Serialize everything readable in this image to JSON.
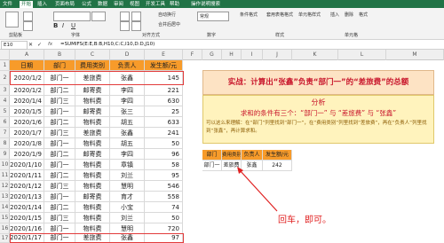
{
  "menu": {
    "tabs": [
      "文件",
      "开始",
      "插入",
      "页面布局",
      "公式",
      "数据",
      "审阅",
      "视图",
      "开发工具",
      "帮助",
      "操作说明搜索"
    ],
    "active": "开始"
  },
  "ribbon": {
    "groups": [
      "剪贴板",
      "字体",
      "对齐方式",
      "数字",
      "样式",
      "单元格"
    ],
    "buttons": [
      "自动换行",
      "合并后居中",
      "常规",
      "条件格式",
      "套用表格格式",
      "单元格样式",
      "插入",
      "删除",
      "格式"
    ]
  },
  "formula_bar": {
    "name_box": "E10",
    "fx": "fx",
    "formula": "=SUMIFS(E:E,B:B,H10,C:C,I10,D:D,J10)"
  },
  "columns": [
    "A",
    "B",
    "C",
    "D",
    "E",
    "F",
    "G",
    "H",
    "I",
    "J",
    "K",
    "L",
    "M"
  ],
  "row_numbers": [
    "1",
    "2",
    "3",
    "4",
    "5",
    "6",
    "7",
    "8",
    "9",
    "10",
    "11",
    "12",
    "13",
    "14",
    "15",
    "16",
    "17"
  ],
  "table": {
    "headers": [
      "日期",
      "部门",
      "费用类别",
      "负责人",
      "发生额/元"
    ],
    "rows": [
      [
        "2020/1/2",
        "部门一",
        "差旅费",
        "张鑫",
        "145"
      ],
      [
        "2020/1/2",
        "部门二",
        "邮寄费",
        "李四",
        "221"
      ],
      [
        "2020/1/4",
        "部门三",
        "物料费",
        "李四",
        "630"
      ],
      [
        "2020/1/5",
        "部门一",
        "邮寄费",
        "张三",
        "25"
      ],
      [
        "2020/1/6",
        "部门二",
        "物料费",
        "胡五",
        "633"
      ],
      [
        "2020/1/7",
        "部门三",
        "差旅费",
        "张鑫",
        "241"
      ],
      [
        "2020/1/8",
        "部门一",
        "物料费",
        "胡五",
        "50"
      ],
      [
        "2020/1/9",
        "部门二",
        "邮寄费",
        "李四",
        "96"
      ],
      [
        "2020/1/10",
        "部门一",
        "物料费",
        "章镇",
        "58"
      ],
      [
        "2020/1/11",
        "部门二",
        "物料费",
        "刘兰",
        "95"
      ],
      [
        "2020/1/12",
        "部门三",
        "物料费",
        "慧明",
        "546"
      ],
      [
        "2020/1/13",
        "部门一",
        "邮寄费",
        "育才",
        "558"
      ],
      [
        "2020/1/14",
        "部门二",
        "物料费",
        "小宝",
        "74"
      ],
      [
        "2020/1/15",
        "部门三",
        "物料费",
        "刘兰",
        "50"
      ],
      [
        "2020/1/16",
        "部门一",
        "物料费",
        "慧明",
        "720"
      ],
      [
        "2020/1/17",
        "部门一",
        "差旅费",
        "张鑫",
        "97"
      ]
    ]
  },
  "panel": {
    "title": "实战：计算出“张鑫”负责“部门一”的“差旅费”的总额",
    "analysis_title": "分析",
    "analysis_text": "求和的条件有三个：“部门一”  与  “差旅费”  与  “张鑫”",
    "analysis_note": "可以这么来理解：在“部门”列里找到“部门一”，在“费用类别”列里找到“差旅费”，再在“负责人”列里找到“张鑫”，再计算求和。"
  },
  "result": {
    "headers": [
      "部门",
      "费用类别",
      "负责人",
      "发生额/元"
    ],
    "values": [
      "部门一",
      "差旅费",
      "张鑫",
      "242"
    ]
  },
  "annotation": "回车，即可。",
  "colors": {
    "accent": "#217346",
    "header_orange": "#f79b2a",
    "highlight_red": "#e23b3b"
  }
}
